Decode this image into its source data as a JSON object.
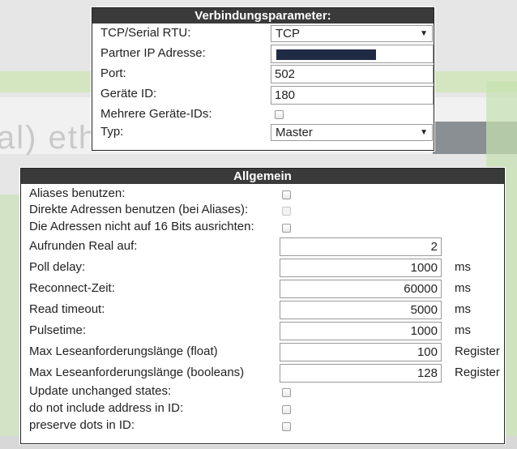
{
  "verbindung": {
    "title": "Verbindungsparameter:",
    "tcp_serial_label": "TCP/Serial RTU:",
    "tcp_serial_value": "TCP",
    "partner_ip_label": "Partner IP Adresse:",
    "port_label": "Port:",
    "port_value": "502",
    "geraete_id_label": "Geräte ID:",
    "geraete_id_value": "180",
    "mehrere_ids_label": "Mehrere Geräte-IDs:",
    "typ_label": "Typ:",
    "typ_value": "Master"
  },
  "allgemein": {
    "title": "Allgemein",
    "aliases_label": "Aliases benutzen:",
    "direkte_label": "Direkte Adressen benutzen (bei Aliases):",
    "nicht16_label": "Die Adressen nicht auf 16 Bits ausrichten:",
    "aufrunden_label": "Aufrunden Real auf:",
    "aufrunden_value": "2",
    "poll_label": "Poll delay:",
    "poll_value": "1000",
    "poll_unit": "ms",
    "reconnect_label": "Reconnect-Zeit:",
    "reconnect_value": "60000",
    "reconnect_unit": "ms",
    "read_label": "Read timeout:",
    "read_value": "5000",
    "read_unit": "ms",
    "pulse_label": "Pulsetime:",
    "pulse_value": "1000",
    "pulse_unit": "ms",
    "maxfloat_label": "Max Leseanforderungslänge (float)",
    "maxfloat_value": "100",
    "maxfloat_unit": "Register",
    "maxbool_label": "Max Leseanforderungslänge (booleans)",
    "maxbool_value": "128",
    "maxbool_unit": "Register",
    "update_label": "Update unchanged states:",
    "noaddr_label": "do not include address in ID:",
    "dots_label": "preserve dots in ID:"
  },
  "background": {
    "watermark_text": "al) eth"
  }
}
